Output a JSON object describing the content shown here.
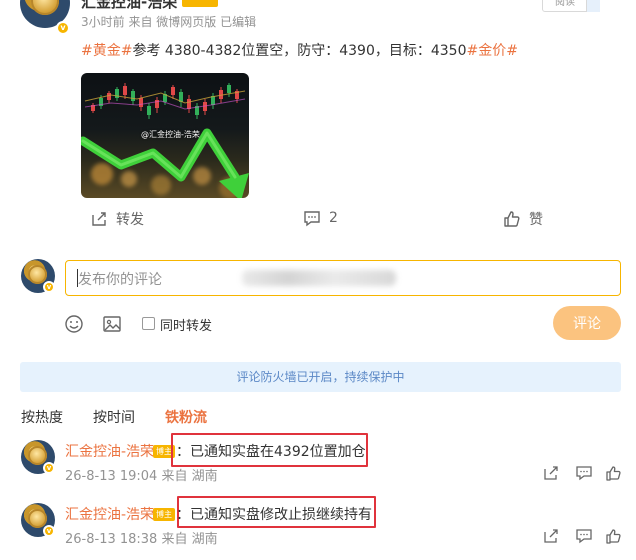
{
  "post": {
    "author": "汇金控油-浩荣",
    "meta": "3小时前  来自 微博网页版 已编辑",
    "read_button": "阅读",
    "text_prefix_tag": "#黄金#",
    "text_body": "参考 4380-4382位置空，防守：4390，目标：4350",
    "text_suffix_tag": "#金价#",
    "image_watermark": "@汇金控油-浩荣",
    "actions": {
      "repost_label": "转发",
      "comment_count": "2",
      "like_label": "赞"
    }
  },
  "compose": {
    "placeholder": "发布你的评论",
    "also_repost_label": "同时转发",
    "submit_label": "评论"
  },
  "firewall_notice": "评论防火墙已开启，持续保护中",
  "sort_tabs": [
    {
      "label": "按热度"
    },
    {
      "label": "按时间"
    },
    {
      "label": "铁粉流"
    }
  ],
  "comments": [
    {
      "author": "汇金控油-浩荣",
      "badge": "博主",
      "text": "：已通知实盘在4392位置加仓",
      "meta": "26-8-13 19:04  来自 湖南"
    },
    {
      "author": "汇金控油-浩荣",
      "badge": "博主",
      "text": "：已通知实盘修改止损继续持有",
      "meta": "26-8-13 18:38  来自 湖南"
    }
  ],
  "colors": {
    "accent_orange": "#eb7340",
    "verified_gold": "#f7b500",
    "highlight_red": "#e0333c",
    "notice_blue_bg": "#e6f2fd"
  }
}
